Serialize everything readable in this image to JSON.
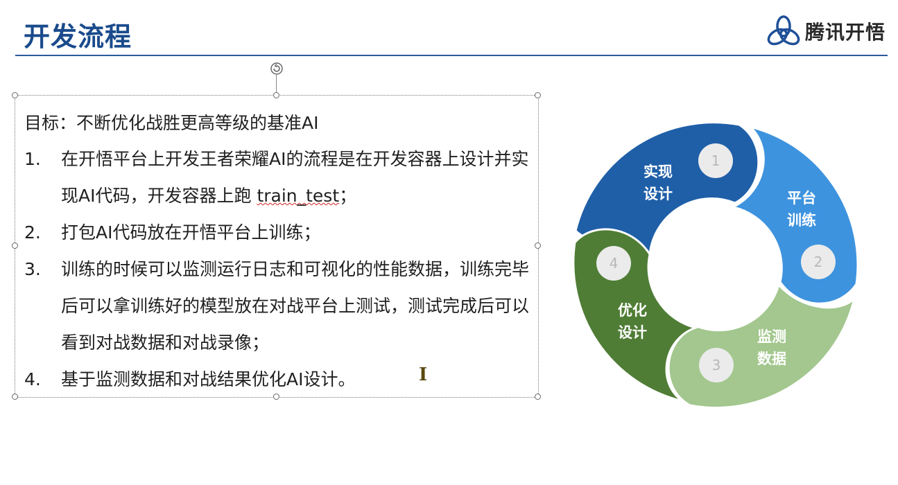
{
  "slide": {
    "title": "开发流程",
    "brand_name": "腾讯开悟",
    "brand_icon": "tencent-kaiwu-logo-icon"
  },
  "content": {
    "goal": "目标：不断优化战胜更高等级的基准AI",
    "items": [
      {
        "num": "1.",
        "text_a": "在开悟平台上开发王者荣耀AI的流程是在开发容器上设计并实现AI代码，开发容器上跑 ",
        "text_b": "train_test",
        "text_c": "；"
      },
      {
        "num": "2.",
        "text": "打包AI代码放在开悟平台上训练；"
      },
      {
        "num": "3.",
        "text": "训练的时候可以监测运行日志和可视化的性能数据，训练完毕后可以拿训练好的模型放在对战平台上测试，测试完成后可以看到对战数据和对战录像；"
      },
      {
        "num": "4.",
        "text": "基于监测数据和对战结果优化AI设计。"
      }
    ]
  },
  "cursor": {
    "glyph": "I",
    "icon": "text-cursor-icon"
  },
  "cycle": {
    "segments": [
      {
        "step": "1",
        "label_line1": "实现",
        "label_line2": "设计",
        "color": "#1f5fa8"
      },
      {
        "step": "2",
        "label_line1": "平台",
        "label_line2": "训练",
        "color": "#3e93de"
      },
      {
        "step": "3",
        "label_line1": "监测",
        "label_line2": "数据",
        "color": "#a3c78e"
      },
      {
        "step": "4",
        "label_line1": "优化",
        "label_line2": "设计",
        "color": "#4f7d35"
      }
    ]
  },
  "colors": {
    "title": "#1a4b8c",
    "rule": "#2a5a9b",
    "step_badge": "#ebebeb",
    "step_number": "#b8b8b8"
  }
}
